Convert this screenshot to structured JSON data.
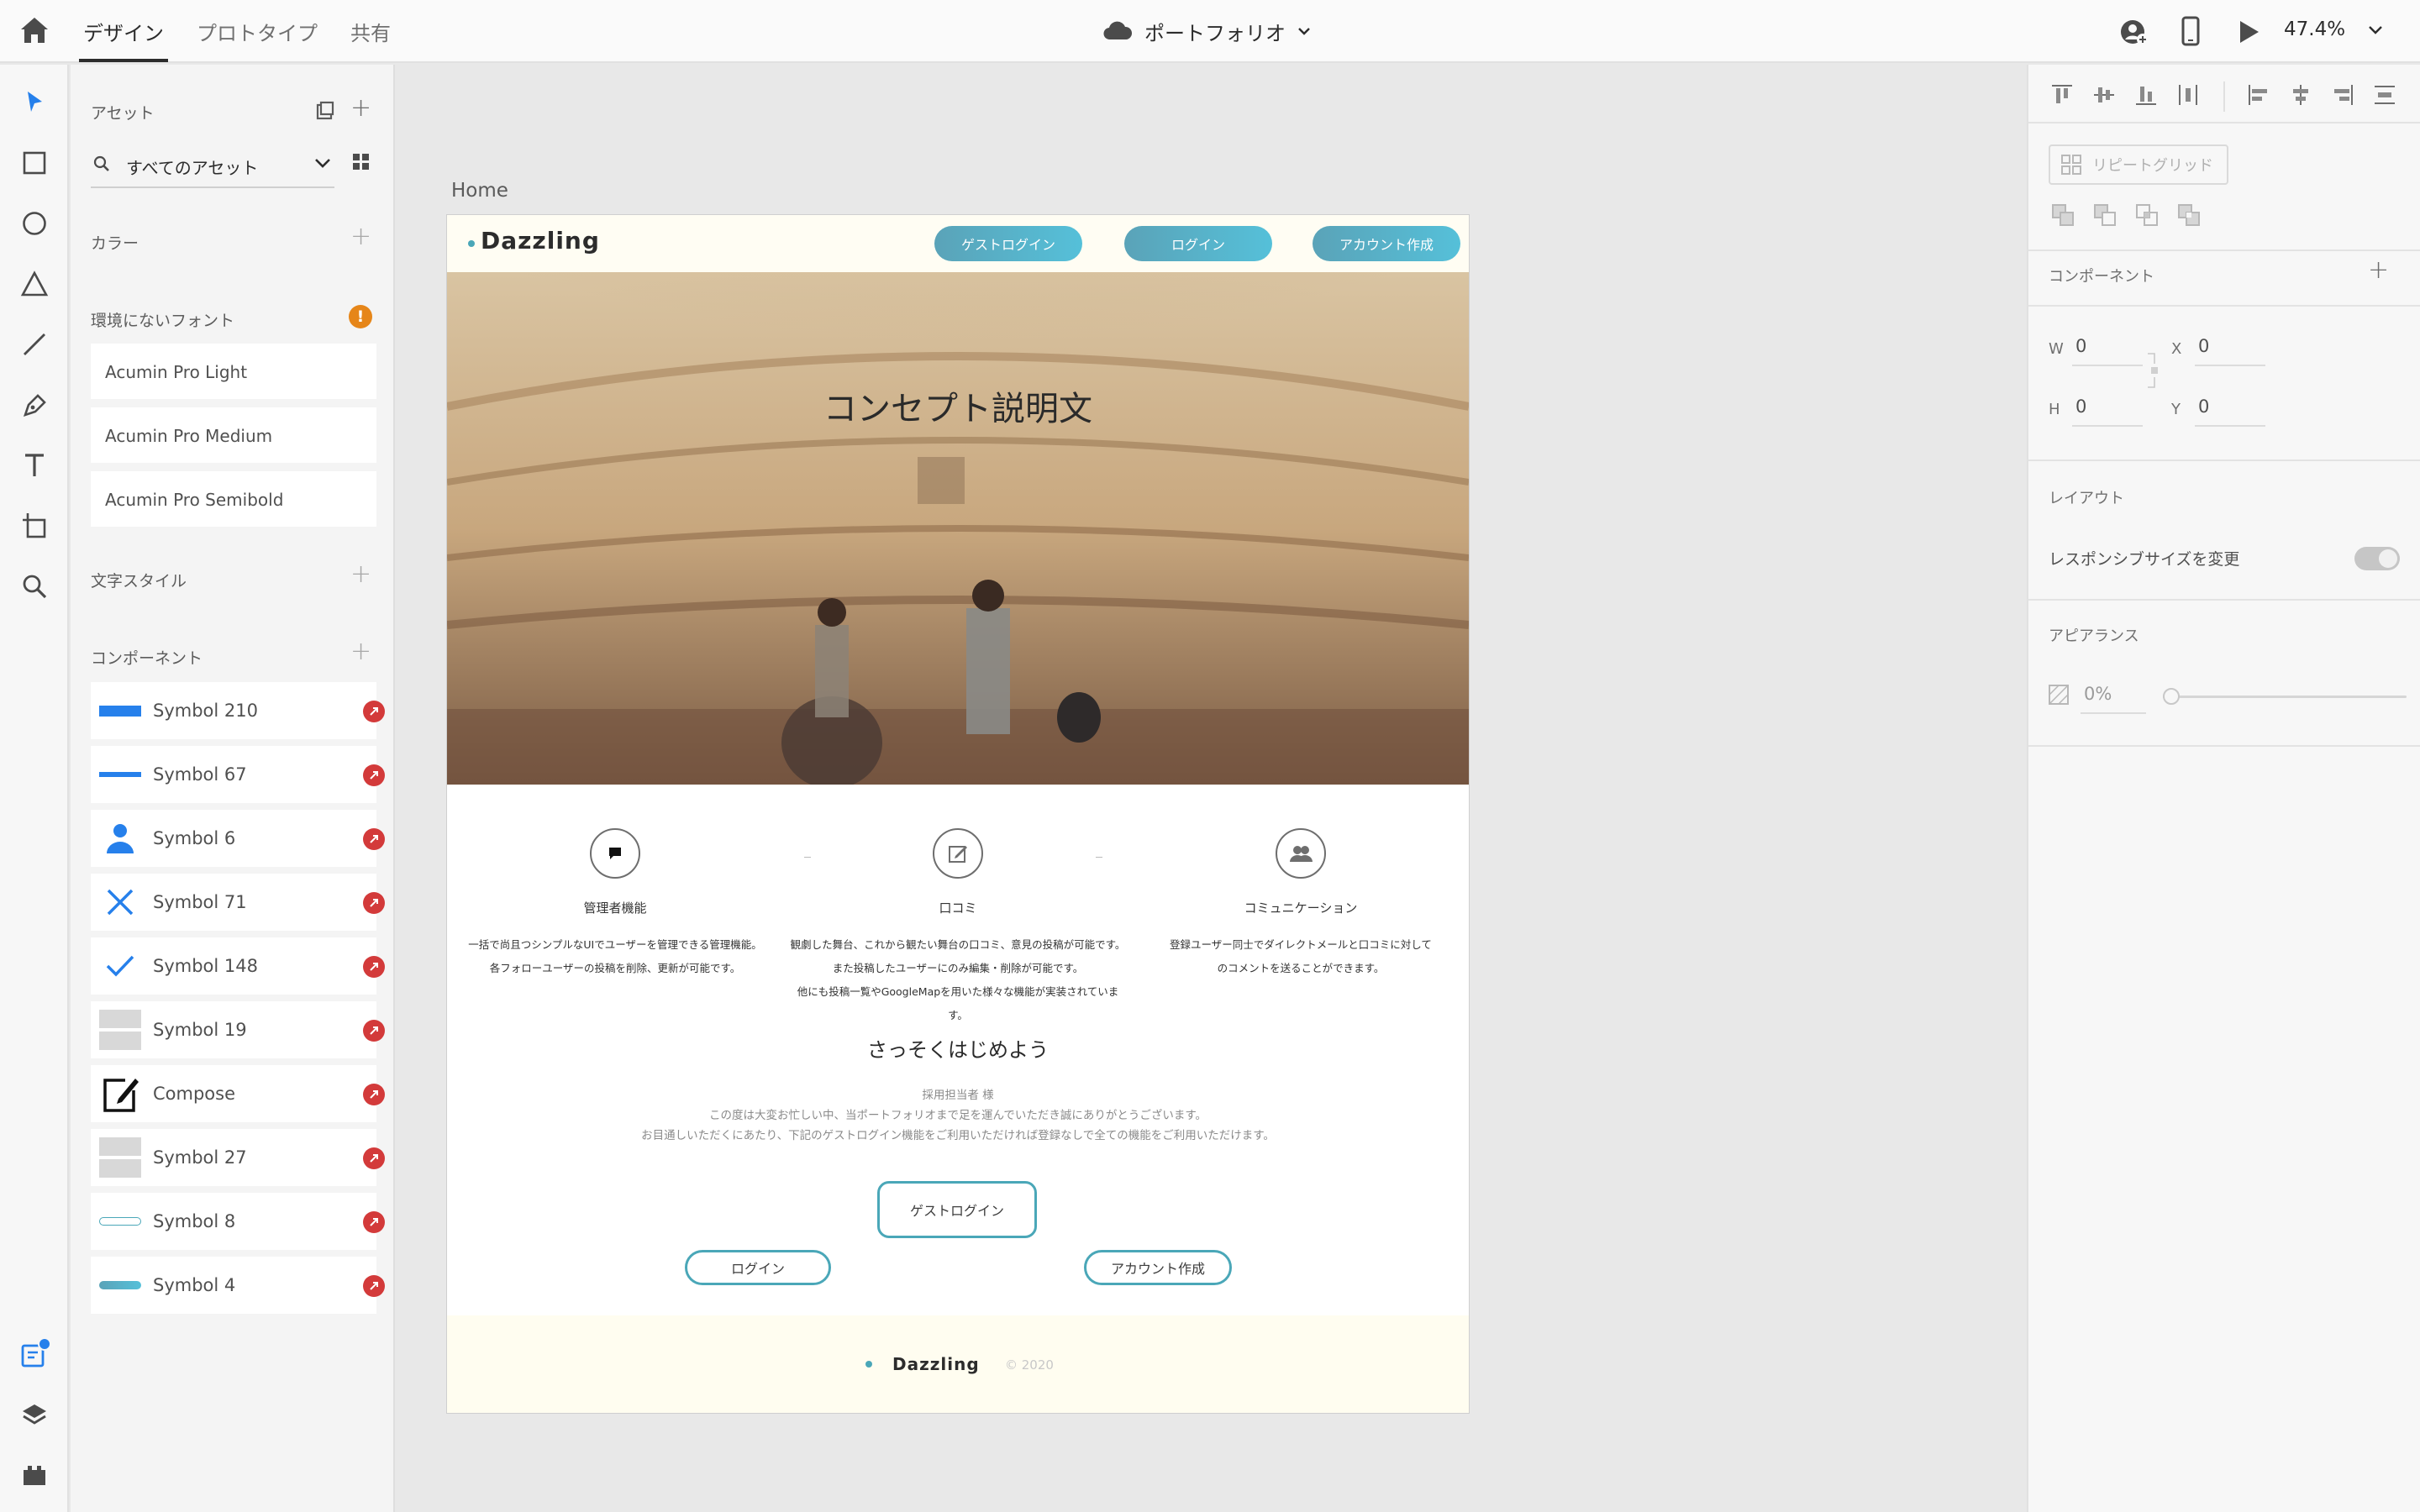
{
  "topbar": {
    "tabs": [
      "デザイン",
      "プロトタイプ",
      "共有"
    ],
    "document_title": "ポートフォリオ",
    "zoom": "47.4%"
  },
  "assets": {
    "title": "アセット",
    "filter": "すべてのアセット",
    "colors_label": "カラー",
    "missing_fonts_label": "環境にないフォント",
    "missing_fonts": [
      "Acumin Pro Light",
      "Acumin Pro Medium",
      "Acumin Pro Semibold"
    ],
    "char_styles_label": "文字スタイル",
    "components_label": "コンポーネント",
    "components": [
      {
        "label": "Symbol 210",
        "thumb": "blue-bar"
      },
      {
        "label": "Symbol 67",
        "thumb": "blue-line"
      },
      {
        "label": "Symbol 6",
        "thumb": "person-icon"
      },
      {
        "label": "Symbol 71",
        "thumb": "x-icon"
      },
      {
        "label": "Symbol 148",
        "thumb": "check-icon"
      },
      {
        "label": "Symbol 19",
        "thumb": "gray-blocks"
      },
      {
        "label": "Compose",
        "thumb": "compose-icon"
      },
      {
        "label": "Symbol 27",
        "thumb": "gray-blocks"
      },
      {
        "label": "Symbol 8",
        "thumb": "outline-pill"
      },
      {
        "label": "Symbol 4",
        "thumb": "gradient-pill"
      }
    ]
  },
  "artboard": {
    "name": "Home",
    "brand": "Dazzling",
    "nav_buttons": [
      "ゲストログイン",
      "ログイン",
      "アカウント作成"
    ],
    "hero_text": "コンセプト説明文",
    "features": [
      {
        "icon": "chat-icon",
        "title": "管理者機能",
        "desc": [
          "一括で尚且つシンプルなUIでユーザーを管理できる管理機能。",
          "各フォローユーザーの投稿を削除、更新が可能です。"
        ]
      },
      {
        "icon": "edit-icon",
        "title": "口コミ",
        "desc": [
          "観劇した舞台、これから観たい舞台の口コミ、意見の投稿が可能です。",
          "また投稿したユーザーにのみ編集・削除が可能です。",
          "他にも投稿一覧やGoogleMapを用いた様々な機能が実装されています。"
        ]
      },
      {
        "icon": "people-icon",
        "title": "コミュニケーション",
        "desc": [
          "登録ユーザー同士でダイレクトメールと口コミに対して",
          "のコメントを送ることができます。"
        ]
      }
    ],
    "cta_title": "さっそくはじめよう",
    "cta_lines": [
      "採用担当者 様",
      "この度は大変お忙しい中、当ポートフォリオまで足を運んでいただき誠にありがとうございます。",
      "お目通しいただくにあたり、下記のゲストログイン機能をご利用いただければ登録なしで全ての機能をご利用いただけます。"
    ],
    "cta_buttons": {
      "guest": "ゲストログイン",
      "login": "ログイン",
      "signup": "アカウント作成"
    },
    "footer_brand": "Dazzling",
    "footer_copy": "© 2020"
  },
  "properties": {
    "repeat_grid": "リピートグリッド",
    "component_label": "コンポーネント",
    "w_label": "W",
    "w": "0",
    "x_label": "X",
    "x": "0",
    "h_label": "H",
    "h": "0",
    "y_label": "Y",
    "y": "0",
    "layout_label": "レイアウト",
    "responsive_label": "レスポンシブサイズを変更",
    "appearance_label": "アピアランス",
    "opacity": "0%"
  },
  "colors": {
    "accent": "#2680eb",
    "brand_teal": "#4aa7b8",
    "warning": "#e68619",
    "link_red": "#d33a3a"
  }
}
